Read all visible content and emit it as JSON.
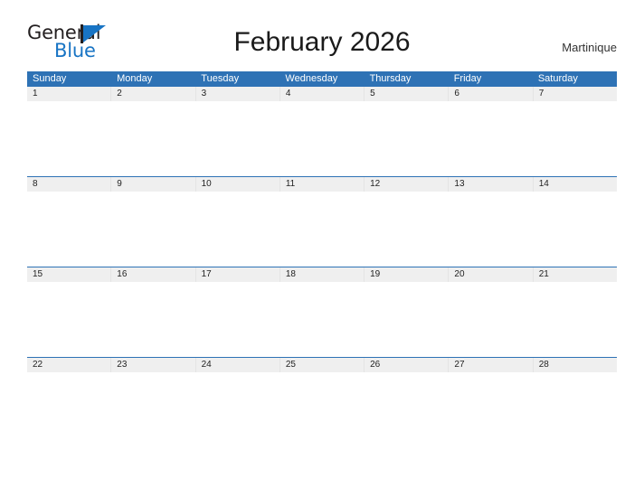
{
  "brand": {
    "line1": "General",
    "line2": "Blue",
    "mark_icon": "general-blue-flag-icon",
    "color_dark": "#231f20",
    "color_blue": "#1874c4"
  },
  "header": {
    "title": "February 2026",
    "locale": "Martinique"
  },
  "calendar": {
    "month": "February",
    "year": "2026",
    "accent_color": "#2e72b5",
    "date_band_color": "#efefef",
    "weekdays": [
      "Sunday",
      "Monday",
      "Tuesday",
      "Wednesday",
      "Thursday",
      "Friday",
      "Saturday"
    ],
    "weeks": [
      {
        "dates": [
          "1",
          "2",
          "3",
          "4",
          "5",
          "6",
          "7"
        ]
      },
      {
        "dates": [
          "8",
          "9",
          "10",
          "11",
          "12",
          "13",
          "14"
        ]
      },
      {
        "dates": [
          "15",
          "16",
          "17",
          "18",
          "19",
          "20",
          "21"
        ]
      },
      {
        "dates": [
          "22",
          "23",
          "24",
          "25",
          "26",
          "27",
          "28"
        ]
      }
    ]
  }
}
